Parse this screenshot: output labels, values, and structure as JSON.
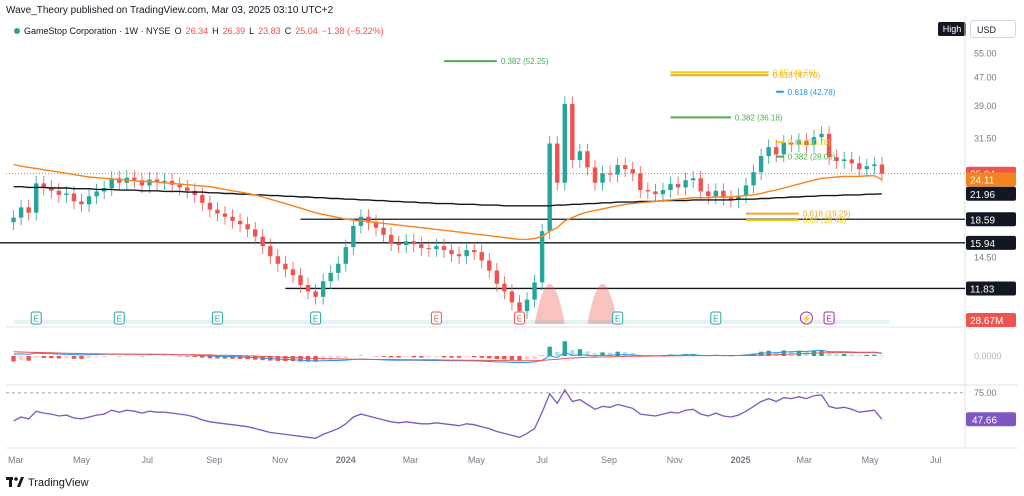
{
  "header": {
    "credit": "Wave_Theory published on TradingView.com, Mar 03, 2025 03:10 UTC+2",
    "brand": "TradingView"
  },
  "symbol": {
    "name": "GameStop Corporation · 1W · NYSE",
    "open_label": "O",
    "open": "26.34",
    "high_label": "H",
    "high": "26.39",
    "low_label": "L",
    "low": "23.83",
    "close_label": "C",
    "close": "25.04",
    "change": "−1.38 (−5.22%)"
  },
  "controls": {
    "high_button": "High",
    "currency_button": "USD"
  },
  "colors": {
    "up": "#26a69a",
    "down": "#ef5350",
    "ema": "#f5841f",
    "sma": "#131722",
    "fib_green": "#4caf50",
    "fib_orange": "#f5a623",
    "fib_yellow": "#f0d000",
    "fib_blue": "#2196f3",
    "rsi": "#7e57c2"
  },
  "price_axis": {
    "ticks": [
      "55.00",
      "47.00",
      "39.00",
      "31.50",
      "25.00",
      "18.50",
      "14.50"
    ]
  },
  "price_labels": [
    {
      "text": "25.04",
      "bg": "#ef5350",
      "fg": "#ffffff",
      "price": 25.04
    },
    {
      "text": "24.11",
      "bg": "#f5841f",
      "fg": "#ffffff",
      "price": 24.11
    },
    {
      "text": "21.96",
      "bg": "#131722",
      "fg": "#ffffff",
      "price": 21.96
    },
    {
      "text": "18.59",
      "bg": "#131722",
      "fg": "#ffffff",
      "price": 18.59
    },
    {
      "text": "15.94",
      "bg": "#131722",
      "fg": "#ffffff",
      "price": 15.94
    },
    {
      "text": "11.83",
      "bg": "#131722",
      "fg": "#ffffff",
      "price": 11.83
    },
    {
      "text": "28.67M",
      "bg": "#ef5350",
      "fg": "#ffffff",
      "price": null
    }
  ],
  "fib_levels": [
    {
      "text": "0.382 (52.25)",
      "color": "#4caf50",
      "price": 52.25,
      "from": "2024-04-01",
      "to": "2024-05-20"
    },
    {
      "text": "0.65 (48.59)",
      "color": "#f0d000",
      "price": 48.59,
      "from": "2024-10-28",
      "to": "2025-01-27"
    },
    {
      "text": "0.618 (47.70)",
      "color": "#f5a623",
      "price": 47.7,
      "from": "2024-10-28",
      "to": "2025-01-27"
    },
    {
      "text": "0.618 (42.78)",
      "color": "#2196f3",
      "price": 42.78,
      "from": "2025-02-03",
      "to": "2025-02-10"
    },
    {
      "text": "0.382 (36.18)",
      "color": "#4caf50",
      "price": 36.18,
      "from": "2024-10-28",
      "to": "2024-12-23"
    },
    {
      "text": "0.65 (30.78)",
      "color": "#f0d000",
      "price": 30.78,
      "from": "2025-02-03",
      "to": "2025-02-10"
    },
    {
      "text": "0.382 (28.00)",
      "color": "#4caf50",
      "price": 28.0,
      "from": "2025-02-03",
      "to": "2025-02-10"
    },
    {
      "text": "0.618 (19.29)",
      "color": "#f5a623",
      "price": 19.29,
      "from": "2025-01-06",
      "to": "2025-02-24"
    },
    {
      "text": "0.65 (18.49)",
      "color": "#f0d000",
      "price": 18.49,
      "from": "2025-01-06",
      "to": "2025-02-24"
    }
  ],
  "horizontal_levels": [
    {
      "price": 18.59,
      "from": "2023-11-20",
      "to": "2025-09-01"
    },
    {
      "price": 15.94,
      "from": "2023-01-01",
      "to": "2025-09-01"
    },
    {
      "price": 11.83,
      "from": "2023-11-06",
      "to": "2025-09-01"
    }
  ],
  "earnings_markers": [
    {
      "date": "2023-03-20",
      "label": "E",
      "kind": "plain"
    },
    {
      "date": "2023-06-05",
      "label": "E",
      "kind": "plain"
    },
    {
      "date": "2023-09-04",
      "label": "E",
      "kind": "plain"
    },
    {
      "date": "2023-12-04",
      "label": "E",
      "kind": "plain"
    },
    {
      "date": "2024-03-25",
      "label": "E",
      "kind": "red"
    },
    {
      "date": "2024-06-10",
      "label": "E",
      "kind": "red"
    },
    {
      "date": "2024-09-09",
      "label": "E",
      "kind": "plain"
    },
    {
      "date": "2024-12-09",
      "label": "E",
      "kind": "plain"
    },
    {
      "date": "2025-03-03",
      "label": "⚡",
      "kind": "purple"
    },
    {
      "date": "2025-03-24",
      "label": "E",
      "kind": "purple"
    }
  ],
  "time_axis": {
    "labels": [
      {
        "text": "Mar",
        "date": "2023-03-01",
        "bold": false
      },
      {
        "text": "May",
        "date": "2023-05-01",
        "bold": false
      },
      {
        "text": "Jul",
        "date": "2023-07-01",
        "bold": false
      },
      {
        "text": "Sep",
        "date": "2023-09-01",
        "bold": false
      },
      {
        "text": "Nov",
        "date": "2023-11-01",
        "bold": false
      },
      {
        "text": "2024",
        "date": "2024-01-01",
        "bold": true
      },
      {
        "text": "Mar",
        "date": "2024-03-01",
        "bold": false
      },
      {
        "text": "May",
        "date": "2024-05-01",
        "bold": false
      },
      {
        "text": "Jul",
        "date": "2024-07-01",
        "bold": false
      },
      {
        "text": "Sep",
        "date": "2024-09-01",
        "bold": false
      },
      {
        "text": "Nov",
        "date": "2024-11-01",
        "bold": false
      },
      {
        "text": "2025",
        "date": "2025-01-01",
        "bold": true
      },
      {
        "text": "Mar",
        "date": "2025-03-01",
        "bold": false
      },
      {
        "text": "May",
        "date": "2025-05-01",
        "bold": false
      },
      {
        "text": "Jul",
        "date": "2025-07-01",
        "bold": false
      }
    ]
  },
  "macd_pane": {
    "axis_label": "0.0000"
  },
  "rsi_pane": {
    "upper_label": "75.00",
    "value": "47.66"
  },
  "chart_data": {
    "type": "line",
    "x_start": "2023-02-27",
    "interval": "1W",
    "close": [
      18.8,
      20.1,
      19.4,
      23.5,
      22.9,
      22.4,
      21.8,
      22.0,
      20.9,
      20.5,
      21.6,
      22.3,
      22.8,
      24.3,
      23.6,
      24.4,
      24.0,
      23.2,
      24.1,
      23.7,
      23.9,
      23.3,
      22.9,
      22.4,
      21.8,
      20.7,
      19.8,
      19.3,
      18.9,
      18.4,
      18.0,
      17.4,
      16.6,
      15.6,
      14.6,
      13.9,
      13.4,
      12.9,
      12.1,
      11.6,
      11.2,
      12.4,
      13.1,
      13.9,
      15.5,
      17.8,
      18.9,
      18.2,
      17.6,
      16.8,
      15.9,
      15.7,
      16.1,
      15.8,
      15.4,
      15.3,
      15.6,
      15.2,
      14.8,
      14.6,
      15.2,
      15.0,
      14.2,
      13.3,
      12.2,
      11.6,
      10.8,
      10.2,
      11.0,
      12.3,
      17.2,
      30.5,
      23.6,
      39.5,
      27.4,
      29.0,
      26.1,
      23.6,
      25.1,
      24.9,
      26.5,
      25.8,
      25.1,
      22.5,
      22.3,
      21.9,
      22.5,
      23.4,
      22.9,
      24.0,
      24.3,
      22.3,
      21.6,
      22.4,
      21.4,
      21.1,
      21.7,
      23.2,
      25.3,
      28.1,
      29.8,
      28.4,
      30.7,
      30.3,
      31.1,
      30.2,
      31.8,
      32.5,
      27.9,
      27.2,
      27.5,
      26.8,
      25.8,
      26.3,
      26.6,
      25.04
    ],
    "ema_50": [
      26.6,
      26.3,
      26.1,
      25.9,
      25.7,
      25.5,
      25.3,
      25.1,
      24.9,
      24.7,
      24.5,
      24.4,
      24.3,
      24.2,
      24.1,
      24.0,
      23.9,
      23.8,
      23.8,
      23.7,
      23.6,
      23.5,
      23.4,
      23.3,
      23.2,
      23.1,
      23.0,
      22.8,
      22.6,
      22.4,
      22.2,
      22.0,
      21.8,
      21.5,
      21.2,
      20.9,
      20.6,
      20.3,
      20.0,
      19.7,
      19.4,
      19.2,
      19.0,
      18.8,
      18.6,
      18.5,
      18.4,
      18.3,
      18.2,
      18.1,
      18.0,
      17.9,
      17.8,
      17.7,
      17.6,
      17.5,
      17.4,
      17.3,
      17.2,
      17.1,
      17.0,
      16.9,
      16.8,
      16.7,
      16.6,
      16.5,
      16.4,
      16.3,
      16.3,
      16.4,
      16.6,
      17.2,
      17.6,
      18.4,
      18.8,
      19.2,
      19.5,
      19.7,
      19.9,
      20.1,
      20.3,
      20.5,
      20.6,
      20.7,
      20.8,
      20.9,
      21.0,
      21.1,
      21.2,
      21.3,
      21.4,
      21.4,
      21.4,
      21.5,
      21.5,
      21.5,
      21.6,
      21.7,
      21.8,
      22.0,
      22.3,
      22.5,
      22.8,
      23.1,
      23.4,
      23.7,
      24.0,
      24.3,
      24.4,
      24.5,
      24.6,
      24.6,
      24.6,
      24.7,
      24.7,
      24.11
    ],
    "sma_200": [
      23.0,
      23.0,
      22.9,
      22.9,
      22.9,
      22.8,
      22.8,
      22.8,
      22.7,
      22.7,
      22.7,
      22.6,
      22.6,
      22.6,
      22.5,
      22.5,
      22.5,
      22.4,
      22.4,
      22.4,
      22.3,
      22.3,
      22.3,
      22.2,
      22.2,
      22.2,
      22.1,
      22.1,
      22.0,
      22.0,
      21.9,
      21.9,
      21.8,
      21.8,
      21.7,
      21.7,
      21.6,
      21.6,
      21.5,
      21.5,
      21.4,
      21.4,
      21.3,
      21.3,
      21.2,
      21.2,
      21.1,
      21.1,
      21.0,
      21.0,
      20.9,
      20.9,
      20.8,
      20.8,
      20.7,
      20.7,
      20.6,
      20.6,
      20.6,
      20.5,
      20.5,
      20.5,
      20.4,
      20.4,
      20.4,
      20.3,
      20.3,
      20.3,
      20.3,
      20.3,
      20.3,
      20.3,
      20.4,
      20.4,
      20.5,
      20.5,
      20.6,
      20.6,
      20.7,
      20.7,
      20.8,
      20.8,
      20.8,
      20.9,
      20.9,
      20.9,
      21.0,
      21.0,
      21.0,
      21.0,
      21.1,
      21.1,
      21.1,
      21.1,
      21.1,
      21.1,
      21.2,
      21.2,
      21.2,
      21.3,
      21.3,
      21.4,
      21.4,
      21.5,
      21.5,
      21.6,
      21.6,
      21.7,
      21.7,
      21.7,
      21.8,
      21.8,
      21.8,
      21.9,
      21.9,
      21.96
    ],
    "rsi": [
      46,
      50,
      48,
      56,
      54,
      53,
      51,
      52,
      49,
      48,
      50,
      52,
      53,
      57,
      55,
      57,
      56,
      54,
      56,
      55,
      55,
      54,
      53,
      52,
      50,
      47,
      45,
      44,
      43,
      42,
      41,
      40,
      38,
      36,
      34,
      33,
      32,
      31,
      30,
      29,
      28,
      32,
      35,
      38,
      43,
      50,
      53,
      51,
      49,
      47,
      45,
      44,
      45,
      44,
      43,
      43,
      44,
      43,
      42,
      41,
      43,
      42,
      40,
      38,
      35,
      33,
      31,
      29,
      33,
      38,
      55,
      74,
      64,
      78,
      66,
      68,
      63,
      58,
      61,
      60,
      63,
      61,
      59,
      53,
      52,
      51,
      53,
      55,
      54,
      57,
      58,
      53,
      51,
      54,
      51,
      50,
      52,
      56,
      61,
      66,
      69,
      66,
      70,
      69,
      71,
      69,
      72,
      73,
      61,
      59,
      60,
      58,
      55,
      56,
      57,
      47.66
    ],
    "ylim": [
      9.5,
      60
    ],
    "scale": "log",
    "grid": false
  }
}
